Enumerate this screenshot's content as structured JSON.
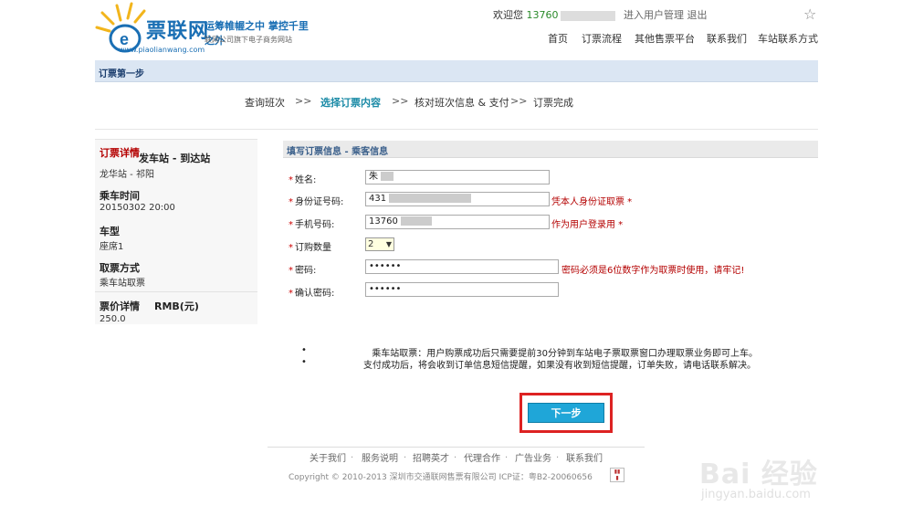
{
  "header": {
    "brand": "票联网",
    "slogan": "运筹帷幄之中 掌控千里之外",
    "subtitle": "联网公司旗下电子商务网站",
    "url": "www.piaolianwang.com",
    "welcome": "欢迎您",
    "phone_prefix": "13760",
    "user_center": "进入用户管理",
    "logout": "退出",
    "nav": [
      "首页",
      "订票流程",
      "其他售票平台",
      "联系我们",
      "车站联系方式"
    ]
  },
  "step_title": "订票第一步",
  "progress": {
    "steps": [
      "查询班次",
      "选择订票内容",
      "核对班次信息 & 支付",
      "订票完成"
    ],
    "separator": ">>",
    "active_index": 1
  },
  "left_panel": {
    "detail_title": "订票详情",
    "route_label": "发车站 - 到达站",
    "route_value": "龙华站 - 祁阳",
    "time_label": "乘车时间",
    "time_value": "20150302  20:00",
    "type_label": "车型",
    "type_value": "座席1",
    "pickup_label": "取票方式",
    "pickup_value": "乘车站取票",
    "price_label": "票价详情",
    "price_unit": "RMB(元)",
    "price_value": "250.0"
  },
  "form": {
    "title": "填写订票信息 - 乘客信息",
    "required_mark": "*",
    "name_label": "姓名:",
    "name_value": "朱",
    "id_label": "身份证号码:",
    "id_value": "431",
    "id_hint": "凭本人身份证取票 *",
    "phone_label": "手机号码:",
    "phone_value": "13760",
    "phone_hint": "作为用户登录用 *",
    "qty_label": "订购数量",
    "qty_value": "2",
    "password_label": "密码:",
    "password_value": "••••••",
    "password_hint": "密码必须是6位数字作为取票时使用，请牢记!",
    "confirm_label": "确认密码:",
    "confirm_value": "••••••"
  },
  "notes": [
    "乘车站取票：用户购票成功后只需要提前30分钟到车站电子票取票窗口办理取票业务即可上车。",
    "支付成功后，将会收到订单信息短信提醒，如果没有收到短信提醒，订单失败，请电话联系解决。"
  ],
  "next_button": "下一步",
  "footer": {
    "links": [
      "关于我们",
      "服务说明",
      "招聘英才",
      "代理合作",
      "广告业务",
      "联系我们"
    ],
    "copyright": "Copyright © 2010-2013 深圳市交通联网售票有限公司 ICP证：粤B2-20060656"
  },
  "watermark": {
    "main": "Bai 经验",
    "sub": "jingyan.baidu.com"
  },
  "colors": {
    "accent": "#1a6fb4",
    "active_step": "#1a8aa6",
    "button": "#1fa6d8",
    "highlight_box": "#dd2222",
    "hint_red": "#b40000"
  }
}
